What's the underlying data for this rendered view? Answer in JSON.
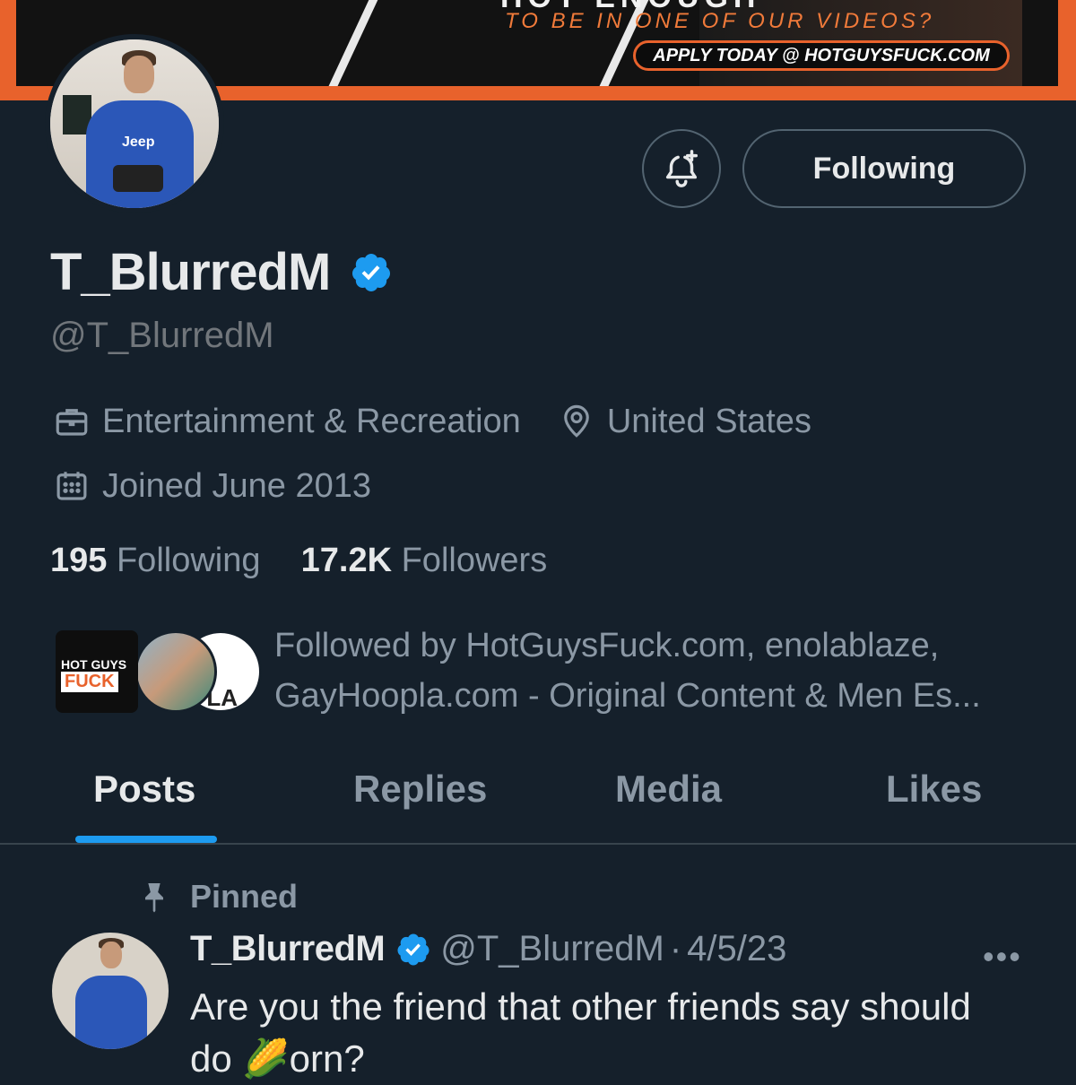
{
  "banner": {
    "tagline": "TO BE IN ONE OF OUR VIDEOS?",
    "cta": "APPLY TODAY @ HOTGUYSFUCK.COM"
  },
  "header": {
    "follow_button": "Following"
  },
  "profile": {
    "display_name": "T_BlurredM",
    "handle": "@T_BlurredM",
    "category": "Entertainment & Recreation",
    "location": "United States",
    "joined": "Joined June 2013",
    "following_count": "195",
    "following_label": "Following",
    "followers_count": "17.2K",
    "followers_label": "Followers",
    "followed_by": "Followed by HotGuysFuck.com, enolablaze, GayHoopla.com - Original Content & Men Es..."
  },
  "followed_by_avatars": {
    "first_logo_top": "HOT GUYS",
    "first_logo_bottom": "FUCK",
    "third_logo": "Y PLA"
  },
  "tabs": [
    {
      "label": "Posts",
      "active": true
    },
    {
      "label": "Replies",
      "active": false
    },
    {
      "label": "Media",
      "active": false
    },
    {
      "label": "Likes",
      "active": false
    }
  ],
  "pinned_post": {
    "pinned_label": "Pinned",
    "author_name": "T_BlurredM",
    "author_handle": "@T_BlurredM",
    "separator": "·",
    "date": "4/5/23",
    "more": "•••",
    "text": "Are you the friend that other friends say should do 🌽orn?"
  },
  "icons": {
    "category": "briefcase-icon",
    "location": "location-pin-icon",
    "joined": "calendar-icon",
    "notify": "bell-plus-icon",
    "pinned": "pin-icon",
    "verified": "verified-badge-icon"
  },
  "colors": {
    "background": "#15202b",
    "accent": "#1d9bf0",
    "banner_orange": "#e8622c",
    "secondary_text": "#8b98a5"
  }
}
